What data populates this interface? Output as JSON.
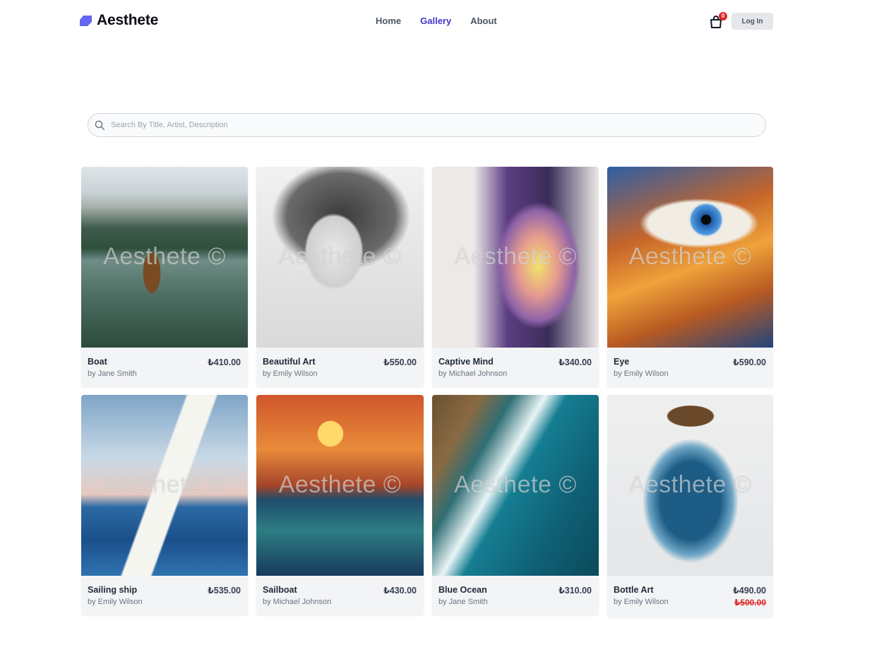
{
  "brand": {
    "name": "Aesthete",
    "color": "#6366f1"
  },
  "nav": [
    {
      "label": "Home",
      "active": false
    },
    {
      "label": "Gallery",
      "active": true
    },
    {
      "label": "About",
      "active": false
    }
  ],
  "cart": {
    "count": "0",
    "icon": "shopping-bag-icon"
  },
  "auth": {
    "login_label": "Log In"
  },
  "search": {
    "placeholder": "Search By Title, Artist, Description",
    "value": "",
    "icon": "search-icon"
  },
  "watermark": "Aesthete ©",
  "artworks": [
    {
      "title": "Boat",
      "artist": "by Jane Smith",
      "price": "₺410.00"
    },
    {
      "title": "Beautiful Art",
      "artist": "by Emily Wilson",
      "price": "₺550.00"
    },
    {
      "title": "Captive Mind",
      "artist": "by Michael Johnson",
      "price": "₺340.00"
    },
    {
      "title": "Eye",
      "artist": "by Emily Wilson",
      "price": "₺590.00"
    },
    {
      "title": "Sailing ship",
      "artist": "by Emily Wilson",
      "price": "₺535.00"
    },
    {
      "title": "Sailboat",
      "artist": "by Michael Johnson",
      "price": "₺430.00"
    },
    {
      "title": "Blue Ocean",
      "artist": "by Jane Smith",
      "price": "₺310.00"
    },
    {
      "title": "Bottle Art",
      "artist": "by Emily Wilson",
      "price": "₺490.00",
      "old_price": "₺500.00"
    }
  ]
}
